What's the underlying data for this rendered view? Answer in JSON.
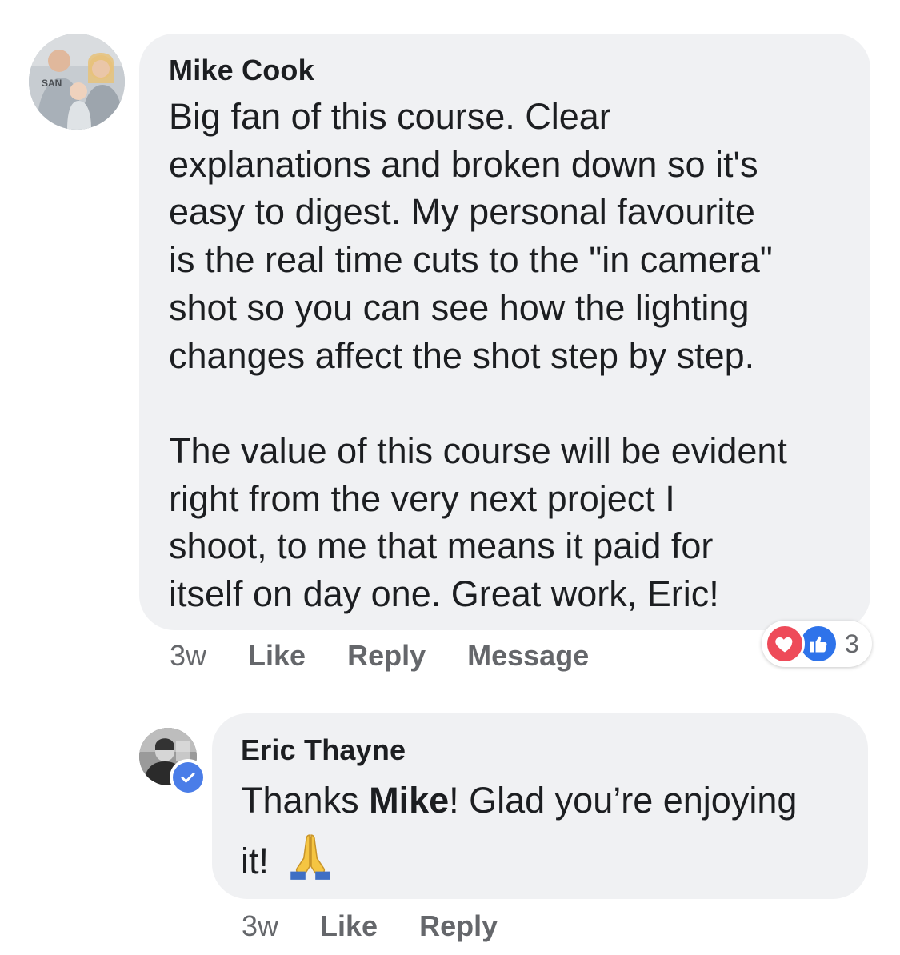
{
  "comments": [
    {
      "author": "Mike Cook",
      "text": "Big fan of this course. Clear\nexplanations and broken down so it's\neasy to digest. My personal favourite\nis the real time cuts to the \"in camera\"\nshot so you can see how the lighting\nchanges affect the shot step by step.\n\nThe value of this course will be evident\nright from the very next project I\nshoot, to me that means it paid for\nitself on day one. Great work, Eric!",
      "time": "3w",
      "actions": [
        "Like",
        "Reply",
        "Message"
      ],
      "reactions": {
        "icons": [
          "love-icon",
          "like-icon"
        ],
        "count": "3"
      }
    },
    {
      "author": "Eric Thayne",
      "text_before": "Thanks ",
      "text_bold": "Mike",
      "text_after": "! Glad you’re enjoying\nit! ",
      "emoji": "folded-hands-emoji",
      "verified": true,
      "time": "3w",
      "actions": [
        "Like",
        "Reply"
      ]
    }
  ],
  "colors": {
    "bubble": "#f0f1f3",
    "muted": "#65676b",
    "love": "#ee4b59",
    "like": "#2e73ea",
    "verified": "#4a7de8"
  }
}
